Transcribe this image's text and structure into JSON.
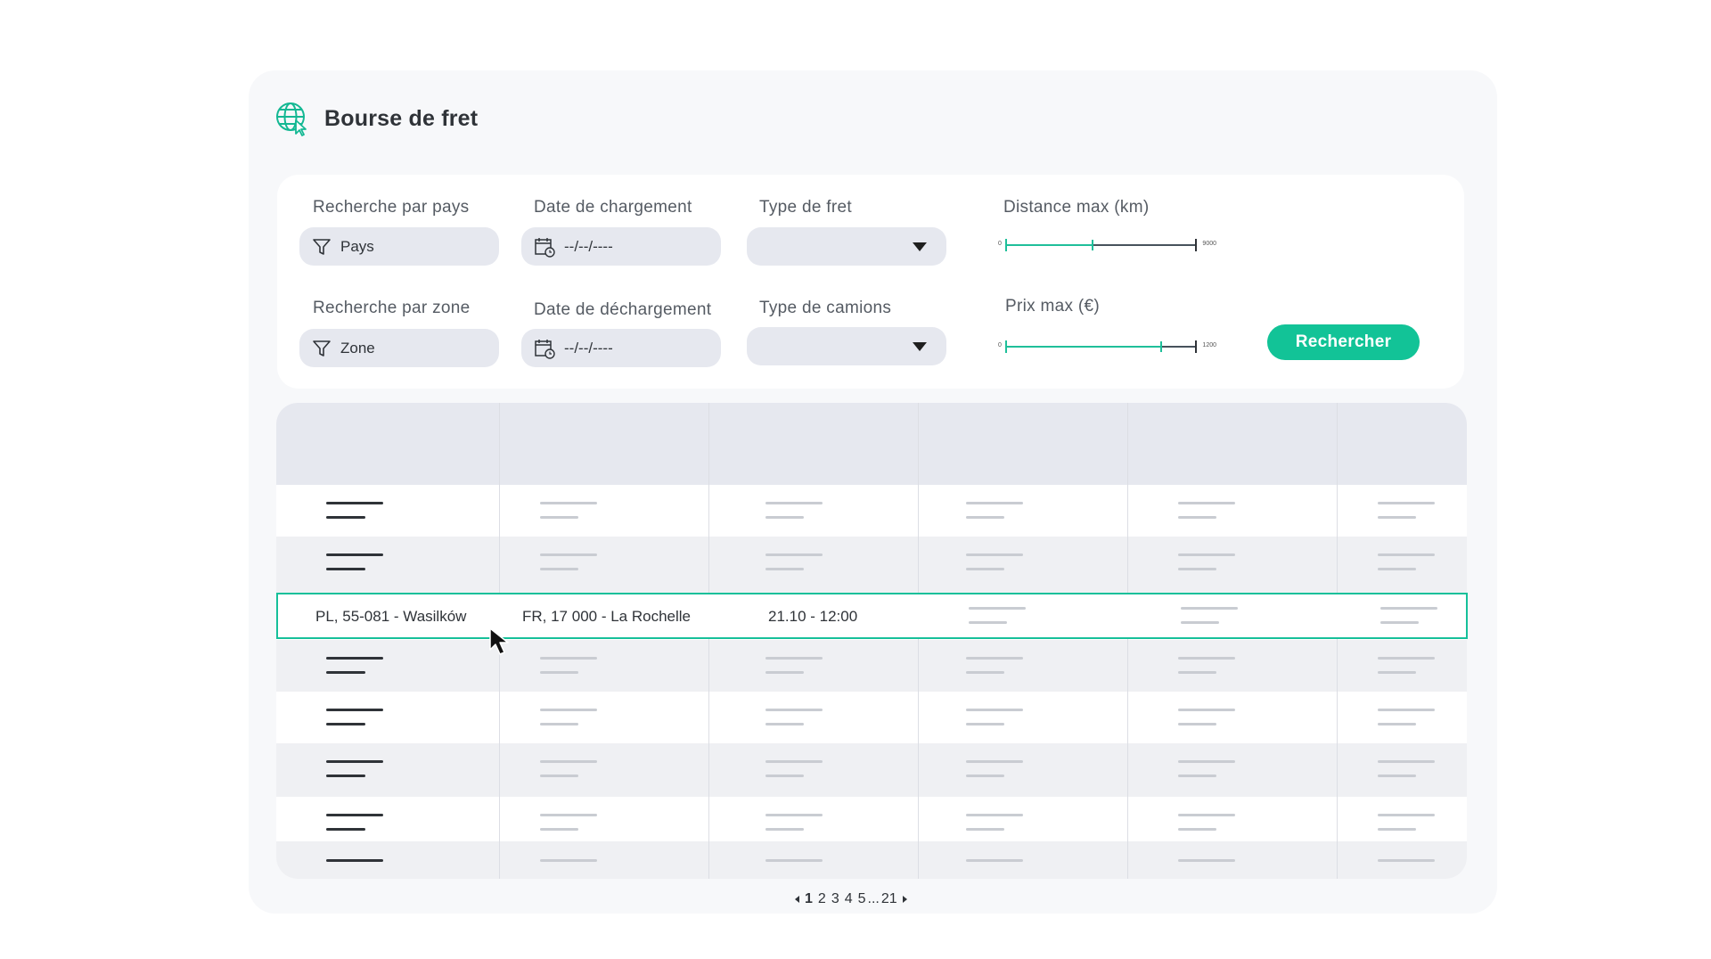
{
  "header": {
    "title": "Bourse de fret",
    "icon": "globe-cursor-icon"
  },
  "filters": {
    "country_label": "Recherche par pays",
    "country_value": "Pays",
    "zone_label": "Recherche par zone",
    "zone_value": "Zone",
    "loading_date_label": "Date de chargement",
    "loading_date_value": "--/--/----",
    "unloading_date_label": "Date de déchargement",
    "unloading_date_value": "--/--/----",
    "freight_type_label": "Type de fret",
    "truck_type_label": "Type de camions",
    "distance_label": "Distance max (km)",
    "distance_min": "0",
    "distance_max": "9000",
    "distance_value": 0.45,
    "price_label": "Prix max (€)",
    "price_min": "0",
    "price_max": "1200",
    "price_value": 0.81,
    "search_button": "Rechercher"
  },
  "table": {
    "selected_row": {
      "origin": "PL, 55-081 - Wasilków",
      "destination": "FR, 17 000 - La Rochelle",
      "datetime": "21.10 - 12:00"
    }
  },
  "pagination": {
    "current": "1",
    "pages": [
      "2",
      "3",
      "4",
      "5"
    ],
    "ellipsis": "...",
    "last": "21"
  },
  "colors": {
    "accent": "#12c397",
    "header_bg": "#e6e8ef",
    "card_bg": "#f7f8fa"
  }
}
